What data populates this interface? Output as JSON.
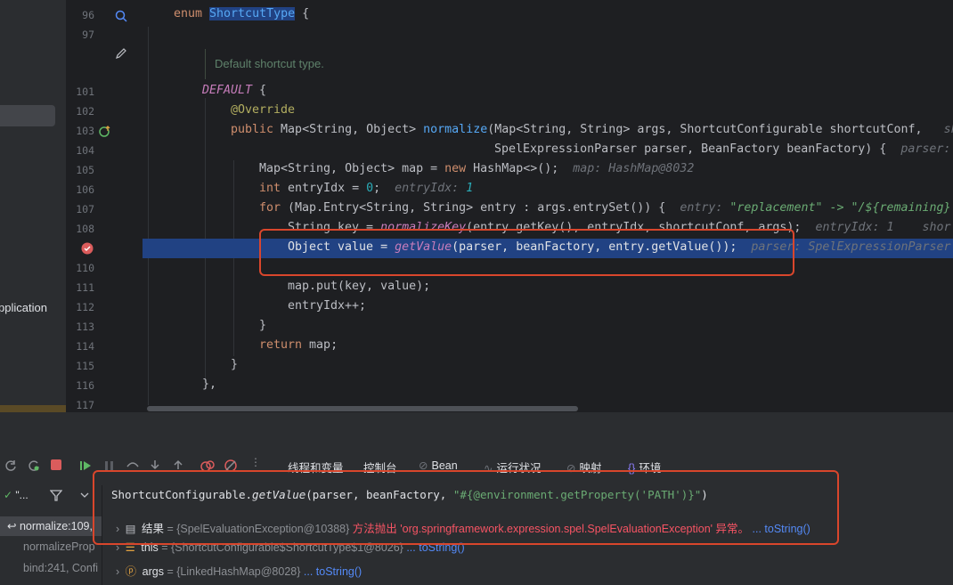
{
  "project_panel": {
    "visible_label": "pplication"
  },
  "editor": {
    "lines": [
      {
        "num": "96"
      },
      {
        "num": "97"
      },
      {
        "num": "101"
      },
      {
        "num": "102"
      },
      {
        "num": "103"
      },
      {
        "num": "104"
      },
      {
        "num": "105"
      },
      {
        "num": "106"
      },
      {
        "num": "107"
      },
      {
        "num": "108"
      },
      {
        "num": "109"
      },
      {
        "num": "110"
      },
      {
        "num": "111"
      },
      {
        "num": "112"
      },
      {
        "num": "113"
      },
      {
        "num": "114"
      },
      {
        "num": "115"
      },
      {
        "num": "116"
      },
      {
        "num": "117"
      }
    ],
    "doc_comment": "Default shortcut type.",
    "code": {
      "l96_kw": "enum ",
      "l96_name": "ShortcutType",
      "l96_rest": " {",
      "l101_name": "DEFAULT",
      "l101_rest": " {",
      "l102": "@Override",
      "l103_kw": "public ",
      "l103_type": "Map<String, Object> ",
      "l103_fn": "normalize",
      "l103_rest": "(Map<String, String> args, ShortcutConfigurable shortcutConf,",
      "l103_hint": "shor",
      "l104": "SpelExpressionParser parser, BeanFactory beanFactory) {",
      "l104_hint": "parser:",
      "l105_a": "Map<String, Object> map = ",
      "l105_kw": "new ",
      "l105_b": "HashMap<>();",
      "l105_hint": "map: HashMap@8032",
      "l106_kw": "int ",
      "l106_a": "entryIdx = ",
      "l106_num": "0",
      "l106_b": ";",
      "l106_hint": "entryIdx: ",
      "l106_hint_num": "1",
      "l107_kw": "for ",
      "l107_a": "(Map.Entry<String, String> entry : args.entrySet()) {",
      "l107_hint": "entry: ",
      "l107_hint_str": "\"replacement\" -> \"/${remaining}",
      "l108_a": "String key = ",
      "l108_fn": "normalizeKey",
      "l108_b": "(entry.getKey(), entryIdx, shortcutConf, args);",
      "l108_hint": "entryIdx: 1    shor",
      "l109_a": "Object value = ",
      "l109_fn": "getValue",
      "l109_b": "(parser, beanFactory, entry.getValue());",
      "l109_hint": "parser: SpelExpressionParser",
      "l111": "map.put(key, value);",
      "l112": "entryIdx++;",
      "l113": "}",
      "l114_kw": "return ",
      "l114_b": "map;",
      "l115": "}",
      "l116": "},"
    }
  },
  "debug": {
    "tabs": [
      {
        "label": "线程和变量"
      },
      {
        "label": "控制台"
      },
      {
        "label": "Bean"
      },
      {
        "label": "运行状况"
      },
      {
        "label": "映射"
      },
      {
        "label": "环境"
      }
    ],
    "thread_filter": "\"...",
    "frames": [
      "normalize:109,",
      "normalizeProp",
      "bind:241, Confi"
    ],
    "eval_expression": {
      "prefix": "ShortcutConfigurable.",
      "method": "getValue",
      "args": "(parser, beanFactory, ",
      "str": "\"#{@environment.getProperty('PATH')}\"",
      "close": ")"
    },
    "variables": [
      {
        "name": "结果",
        "value": " = {SpelEvaluationException@10388} ",
        "message": "方法抛出 'org.springframework.expression.spel.SpelEvaluationException' 异常。",
        "link": "... toString()"
      },
      {
        "name": "this",
        "value": " = {ShortcutConfigurable$ShortcutType$1@8026} ",
        "link": "... toString()"
      },
      {
        "name": "args",
        "value": " = {LinkedHashMap@8028} ",
        "link": "... toString()"
      }
    ]
  }
}
